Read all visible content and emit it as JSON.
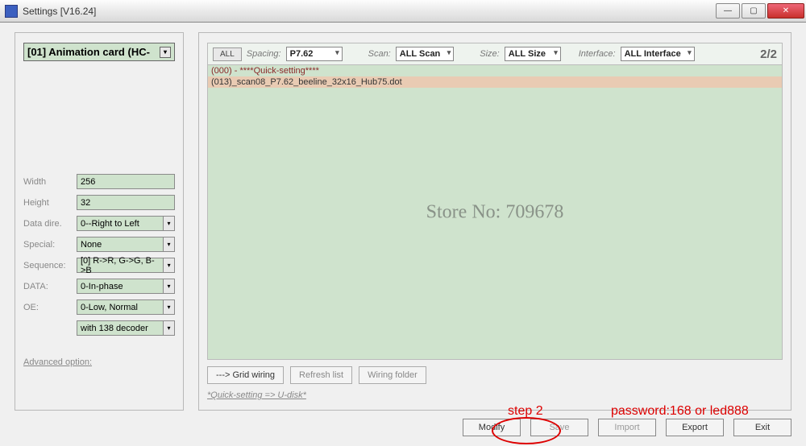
{
  "window": {
    "title": "Settings [V16.24]"
  },
  "left": {
    "card": "[01] Animation card (HC-",
    "fields": {
      "width_label": "Width",
      "width_value": "256",
      "height_label": "Height",
      "height_value": "32",
      "dire_label": "Data dire.",
      "dire_value": "0--Right to Left",
      "special_label": "Special:",
      "special_value": "None",
      "seq_label": "Sequence:",
      "seq_value": "[0] R->R, G->G, B->B",
      "data_label": "DATA:",
      "data_value": "0-In-phase",
      "oe_label": "OE:",
      "oe_value": "0-Low, Normal",
      "decoder_value": "with 138 decoder"
    },
    "advanced": "Advanced option:"
  },
  "filters": {
    "all_btn": "ALL",
    "spacing_label": "Spacing:",
    "spacing_value": "P7.62",
    "scan_label": "Scan:",
    "scan_value": "ALL Scan",
    "size_label": "Size:",
    "size_value": "ALL Size",
    "interface_label": "Interface:",
    "interface_value": "ALL Interface",
    "count": "2/2"
  },
  "list": {
    "row0": "(000) - ****Quick-setting****",
    "row1": "(013)_scan08_P7.62_beeline_32x16_Hub75.dot"
  },
  "watermark": "Store No: 709678",
  "mid_buttons": {
    "grid": "---> Grid wiring",
    "refresh": "Refresh list",
    "folder": "Wiring folder"
  },
  "quick_link": "*Quick-setting => U-disk*",
  "bottom_buttons": {
    "modify": "Modify",
    "save": "Save",
    "import": "Import",
    "export": "Export",
    "exit": "Exit"
  },
  "annotations": {
    "step": "step 2",
    "password": "password:168 or led888"
  }
}
